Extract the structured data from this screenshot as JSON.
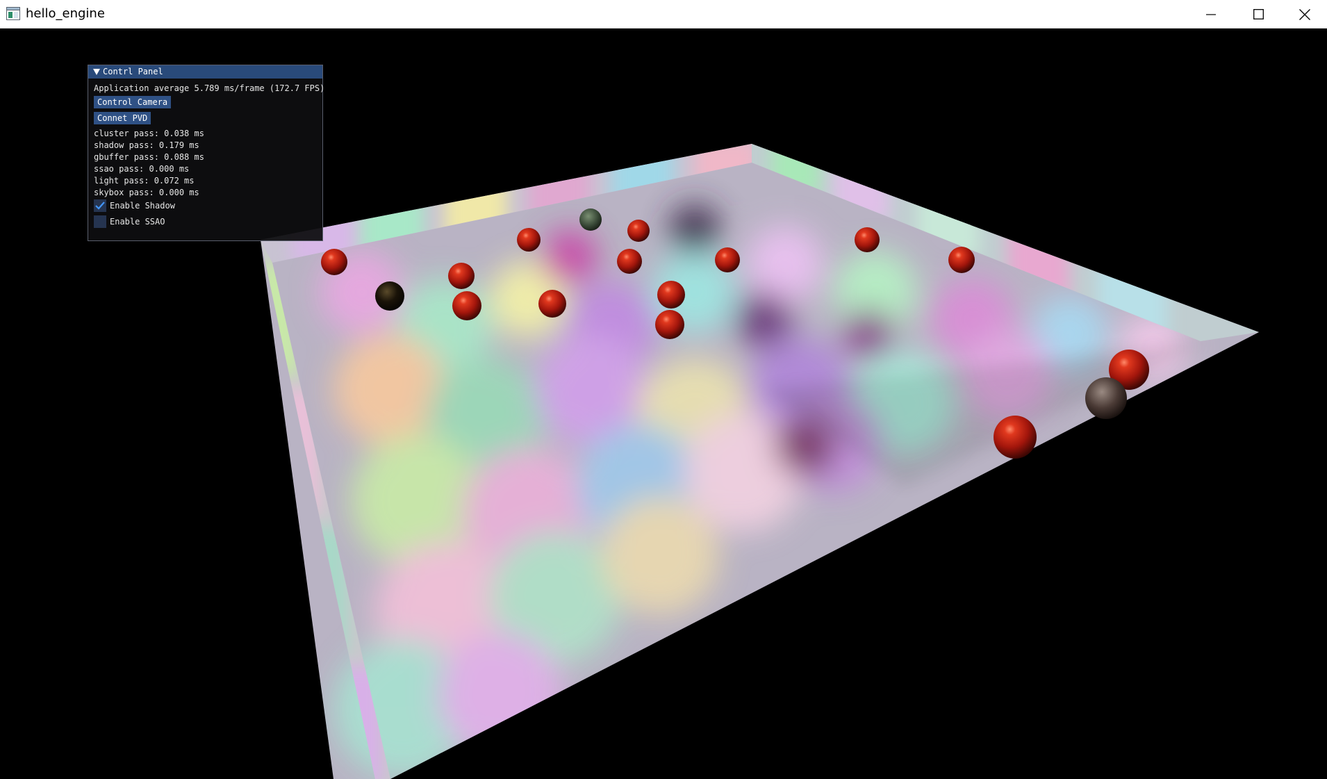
{
  "window": {
    "title": "hello_engine",
    "icons": [
      "app-window-icon",
      "minimize-icon",
      "maximize-icon",
      "close-icon"
    ]
  },
  "panel": {
    "title": "Contrl Panel",
    "fps_text": "Application average 5.789 ms/frame (172.7 FPS)",
    "buttons": {
      "control_camera": "Control Camera",
      "connect_pvd": "Connet PVD"
    },
    "timings": [
      "cluster pass: 0.038 ms",
      "shadow pass: 0.179 ms",
      "gbuffer pass: 0.088 ms",
      "ssao pass: 0.000 ms",
      "light pass: 0.072 ms",
      "skybox pass: 0.000 ms"
    ],
    "checkboxes": {
      "shadow": {
        "label": "Enable Shadow",
        "checked": true
      },
      "ssao": {
        "label": "Enable SSAO",
        "checked": false
      }
    }
  },
  "colors": {
    "panel_header": "#294a7a",
    "button": "#2f5185",
    "checkbox_bg": "#253450",
    "check_mark": "#4296fa",
    "sphere": "#b01a10"
  }
}
